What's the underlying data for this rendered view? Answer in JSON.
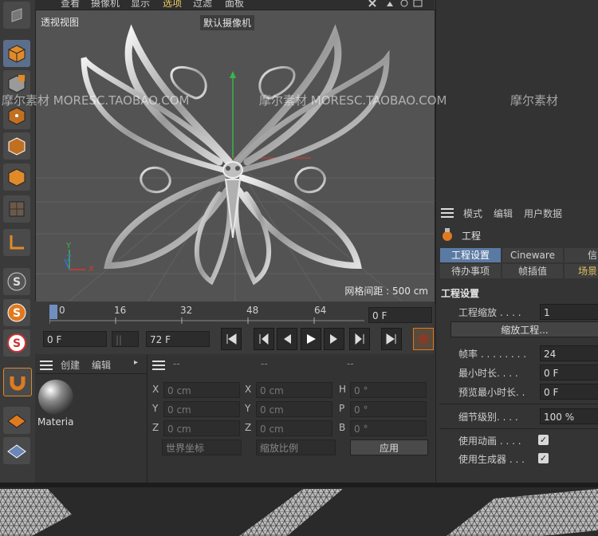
{
  "menu": {
    "items": [
      "查看",
      "摄像机",
      "显示",
      "选项",
      "过滤",
      "面板"
    ]
  },
  "viewport": {
    "label": "透视视图",
    "camera_label": "默认摄像机",
    "grid_spacing": "网格间距 : 500 cm",
    "axes": {
      "x": "X",
      "y": "Y",
      "z": "Z"
    }
  },
  "watermarks": [
    "摩尔素材  MORESC.TAOBAO.COM",
    "摩尔素材  MORESC.TAOBAO.COM",
    "摩尔素材"
  ],
  "timeline": {
    "ticks": [
      "0",
      "16",
      "32",
      "48",
      "64"
    ],
    "current_frame": "0 F",
    "start_frame": "0 F",
    "end_frame": "72 F"
  },
  "material_panel": {
    "menu": [
      "创建",
      "编辑"
    ],
    "material_name": "Materia"
  },
  "coord_panel": {
    "headers": [
      "--",
      "--",
      "--"
    ],
    "rows": [
      {
        "l1": "X",
        "v1": "0 cm",
        "l2": "X",
        "v2": "0 cm",
        "l3": "H",
        "v3": "0 °"
      },
      {
        "l1": "Y",
        "v1": "0 cm",
        "l2": "Y",
        "v2": "0 cm",
        "l3": "P",
        "v3": "0 °"
      },
      {
        "l1": "Z",
        "v1": "0 cm",
        "l2": "Z",
        "v2": "0 cm",
        "l3": "B",
        "v3": "0 °"
      }
    ],
    "world_coords": "世界坐标",
    "scale": "缩放比例",
    "apply": "应用"
  },
  "attr_panel": {
    "menu": [
      "模式",
      "编辑",
      "用户数据"
    ],
    "title": "工程",
    "tabs": [
      "工程设置",
      "Cineware",
      "信"
    ],
    "tabs2": [
      "待办事项",
      "帧插值",
      "场景"
    ],
    "section": "工程设置",
    "props": {
      "scale_label": "工程缩放 . . . .",
      "scale_value": "1",
      "scale_button": "缩放工程...",
      "fps_label": "帧率 . . . . . . . .",
      "fps_value": "24",
      "min_time_label": "最小时长. . . .",
      "min_time_value": "0 F",
      "preview_min_label": "预览最小时长. .",
      "preview_min_value": "0 F",
      "lod_label": "细节级别. . . .",
      "lod_value": "100 %",
      "use_anim_label": "使用动画 . . . .",
      "use_gen_label": "使用生成器 . . ."
    }
  },
  "colors": {
    "accent": "#5b7aa3",
    "orange": "#e07a1f",
    "silver": "#d0d0d0"
  }
}
